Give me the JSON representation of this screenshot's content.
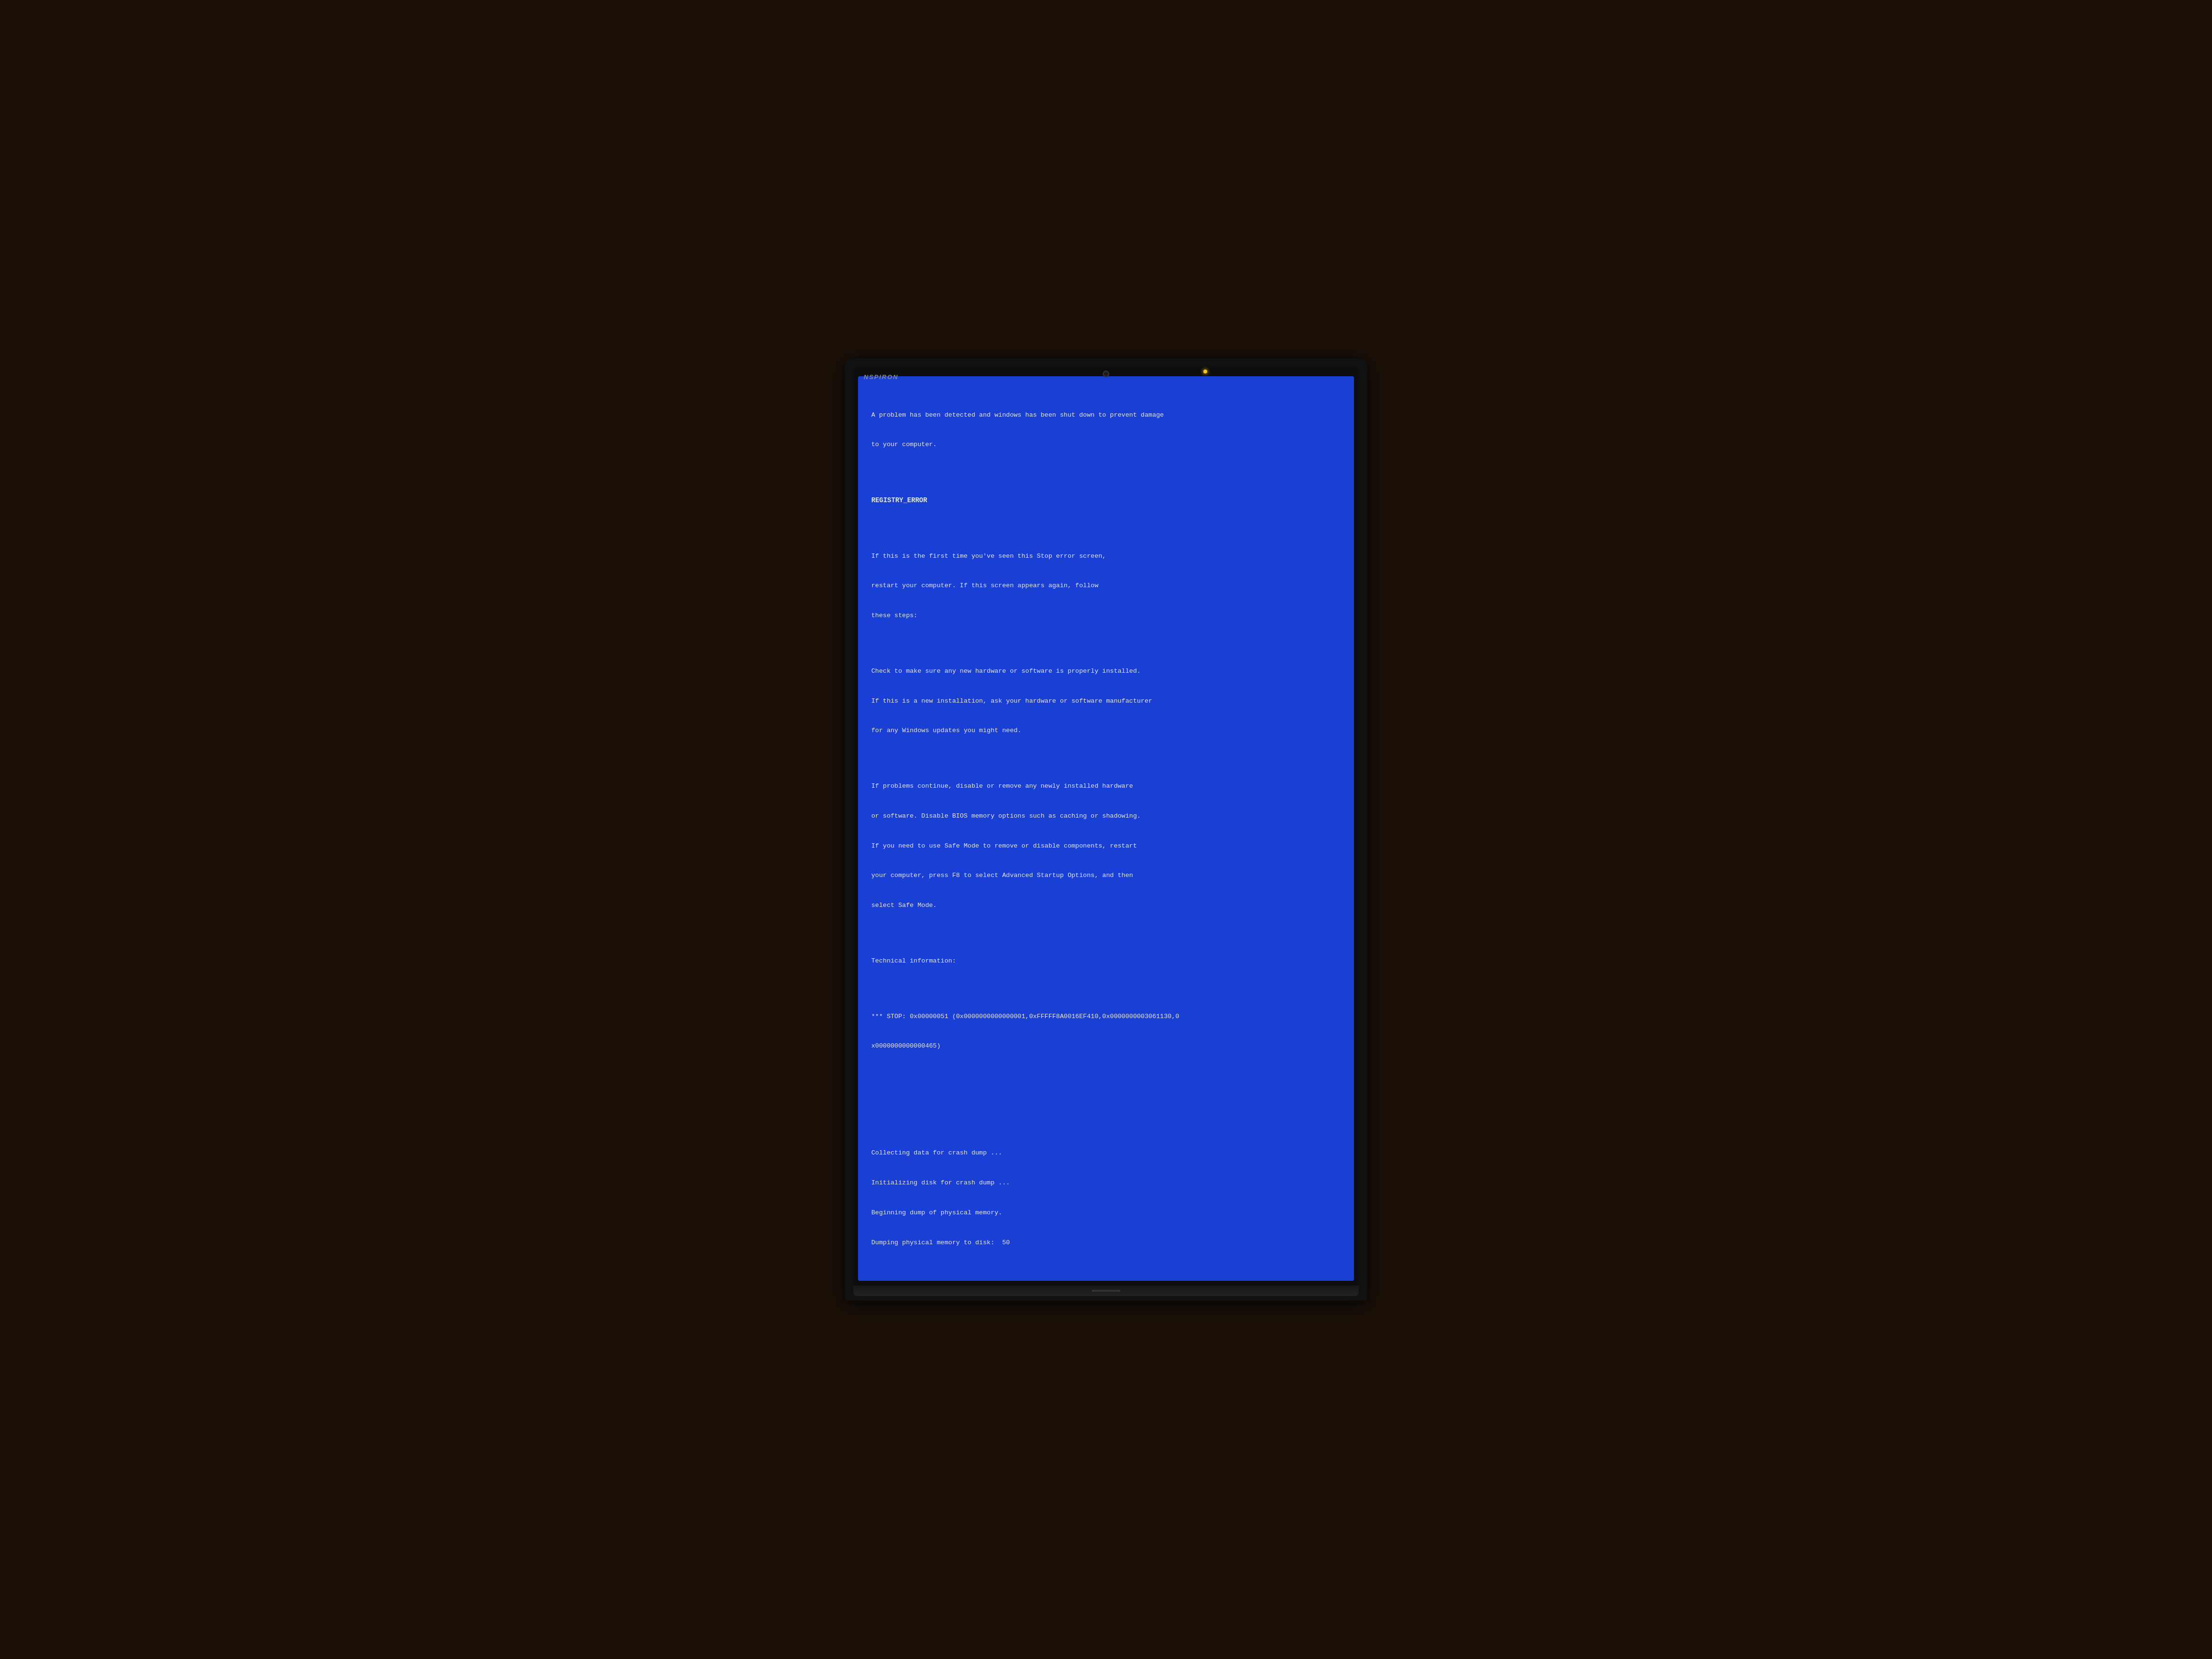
{
  "laptop": {
    "brand": "NSPIRON",
    "indicator_color": "#f5c518"
  },
  "bsod": {
    "line1": "A problem has been detected and windows has been shut down to prevent damage",
    "line2": "to your computer.",
    "spacer1": "",
    "error_code": "REGISTRY_ERROR",
    "spacer2": "",
    "line3": "If this is the first time you've seen this Stop error screen,",
    "line4": "restart your computer. If this screen appears again, follow",
    "line5": "these steps:",
    "spacer3": "",
    "line6": "Check to make sure any new hardware or software is properly installed.",
    "line7": "If this is a new installation, ask your hardware or software manufacturer",
    "line8": "for any Windows updates you might need.",
    "spacer4": "",
    "line9": "If problems continue, disable or remove any newly installed hardware",
    "line10": "or software. Disable BIOS memory options such as caching or shadowing.",
    "line11": "If you need to use Safe Mode to remove or disable components, restart",
    "line12": "your computer, press F8 to select Advanced Startup Options, and then",
    "line13": "select Safe Mode.",
    "spacer5": "",
    "line14": "Technical information:",
    "spacer6": "",
    "stop_line1": "*** STOP: 0x00000051 (0x0000000000000001,0xFFFFF8A0016EF410,0x0000000003061130,0",
    "stop_line2": "x0000000000000465)",
    "spacer7": "",
    "spacer8": "",
    "spacer9": "",
    "dump_line1": "Collecting data for crash dump ...",
    "dump_line2": "Initializing disk for crash dump ...",
    "dump_line3": "Beginning dump of physical memory.",
    "dump_line4": "Dumping physical memory to disk:  50"
  }
}
